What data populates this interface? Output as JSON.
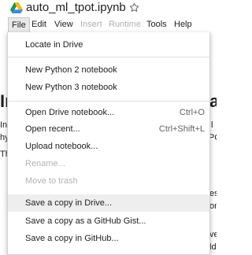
{
  "header": {
    "notebook_title": "auto_ml_tpot.ipynb",
    "logo_icon": "google-drive-icon",
    "star_icon": "star-outline-icon"
  },
  "menubar": {
    "items": [
      {
        "label": "File",
        "state": "active"
      },
      {
        "label": "Edit",
        "state": "enabled"
      },
      {
        "label": "View",
        "state": "enabled"
      },
      {
        "label": "Insert",
        "state": "disabled"
      },
      {
        "label": "Runtime",
        "state": "disabled"
      },
      {
        "label": "Tools",
        "state": "enabled"
      },
      {
        "label": "Help",
        "state": "enabled"
      }
    ]
  },
  "file_menu": {
    "groups": [
      [
        {
          "label": "Locate in Drive",
          "shortcut": "",
          "disabled": false
        }
      ],
      [
        {
          "label": "New Python 2 notebook",
          "shortcut": "",
          "disabled": false
        },
        {
          "label": "New Python 3 notebook",
          "shortcut": "",
          "disabled": false
        }
      ],
      [
        {
          "label": "Open Drive notebook...",
          "shortcut": "Ctrl+O",
          "disabled": false
        },
        {
          "label": "Open recent...",
          "shortcut": "Ctrl+Shift+L",
          "disabled": false
        },
        {
          "label": "Upload notebook...",
          "shortcut": "",
          "disabled": false
        },
        {
          "label": "Rename...",
          "shortcut": "",
          "disabled": true
        },
        {
          "label": "Move to trash",
          "shortcut": "",
          "disabled": true
        }
      ],
      [
        {
          "label": "Save a copy in Drive...",
          "shortcut": "",
          "disabled": false,
          "hovered": true
        },
        {
          "label": "Save a copy as a GitHub Gist...",
          "shortcut": "",
          "disabled": false
        },
        {
          "label": "Save a copy in GitHub...",
          "shortcut": "",
          "disabled": false
        }
      ]
    ]
  },
  "background": {
    "heading_left": "In",
    "heading_right": "a",
    "left_lines": [
      "In",
      "hy",
      "Th"
    ],
    "right_lines": [
      "l",
      "PO",
      "es",
      "om",
      "ve",
      "ld"
    ]
  }
}
